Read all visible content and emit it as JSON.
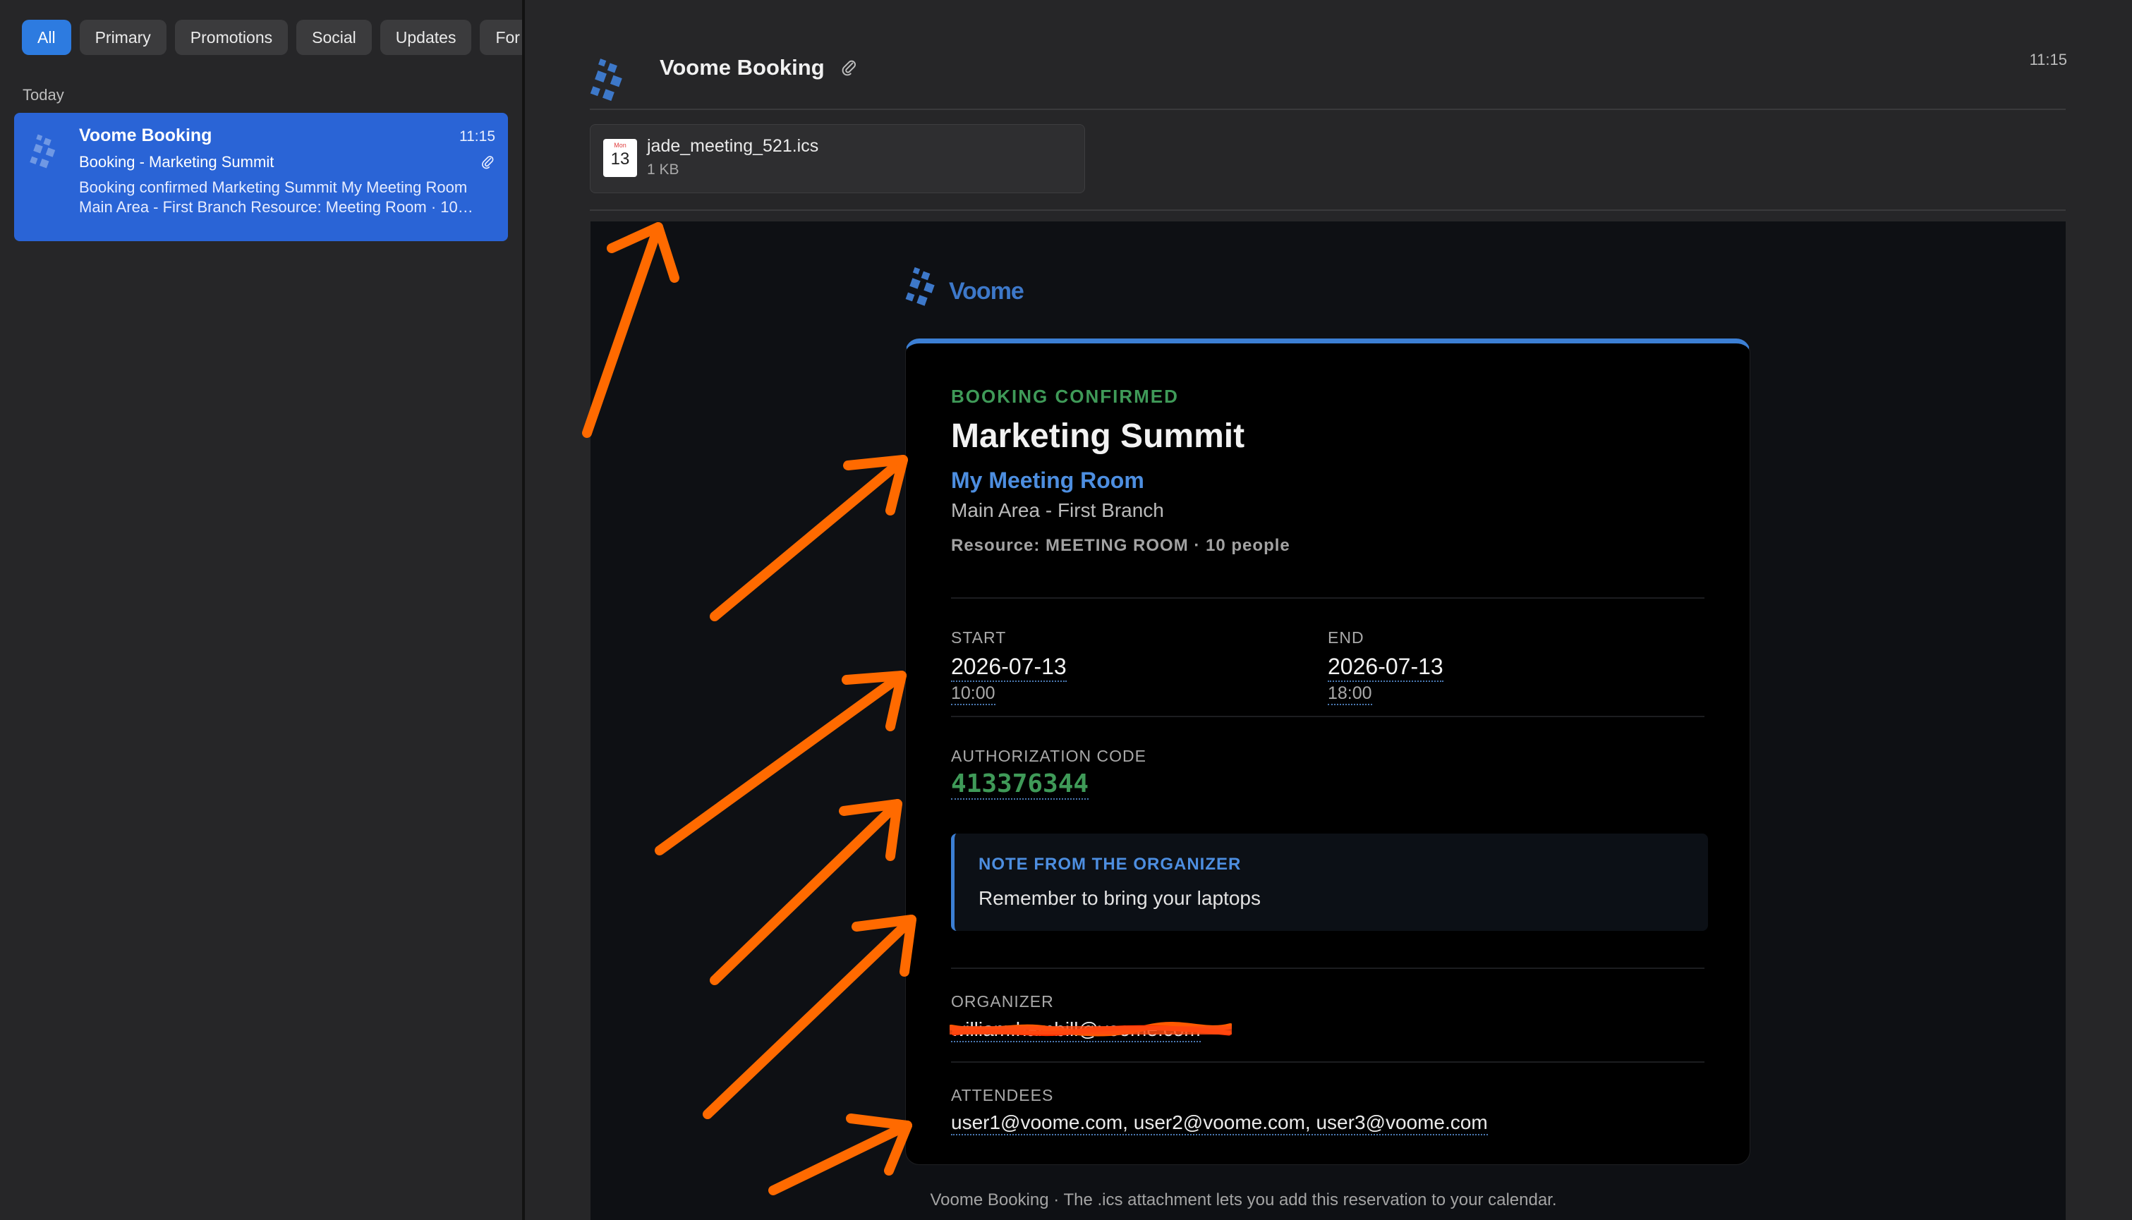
{
  "sidebar": {
    "tabs": [
      {
        "label": "All"
      },
      {
        "label": "Primary"
      },
      {
        "label": "Promotions"
      },
      {
        "label": "Social"
      },
      {
        "label": "Updates"
      },
      {
        "label": "For"
      }
    ],
    "group_label": "Today",
    "mail_item": {
      "sender": "Voome Booking",
      "time": "11:15",
      "subject": "Booking - Marketing Summit",
      "preview": "Booking confirmed Marketing Summit My Meeting Room Main Area - First Branch Resource: Meeting Room · 10…"
    }
  },
  "reader": {
    "sender": "Voome Booking",
    "time": "11:15",
    "attachment": {
      "name": "jade_meeting_521.ics",
      "size": "1 KB",
      "month": "Mon",
      "day": "13"
    },
    "body": {
      "logo_text": "Voome",
      "status": "BOOKING CONFIRMED",
      "title": "Marketing Summit",
      "room": "My Meeting Room",
      "location": "Main Area - First Branch",
      "resource": "Resource: MEETING ROOM · 10 people",
      "start": {
        "label": "START",
        "date": "2026-07-13",
        "time": "10:00"
      },
      "end": {
        "label": "END",
        "date": "2026-07-13",
        "time": "18:00"
      },
      "auth": {
        "label": "AUTHORIZATION CODE",
        "code": "413376344"
      },
      "note": {
        "title": "NOTE FROM THE ORGANIZER",
        "text": "Remember to bring your laptops"
      },
      "organizer": {
        "label": "ORGANIZER",
        "email": "william.hambill@voome.com"
      },
      "attendees": {
        "label": "ATTENDEES",
        "list": "user1@voome.com, user2@voome.com, user3@voome.com"
      },
      "footer": "Voome Booking · The .ics attachment lets you add this reservation to your calendar."
    }
  },
  "colors": {
    "accent_blue": "#2d7be0",
    "selected_item": "#2a64d6",
    "success_green": "#3f9a58",
    "link_blue": "#4d8ee0",
    "annotation_orange": "#ff6a00"
  }
}
